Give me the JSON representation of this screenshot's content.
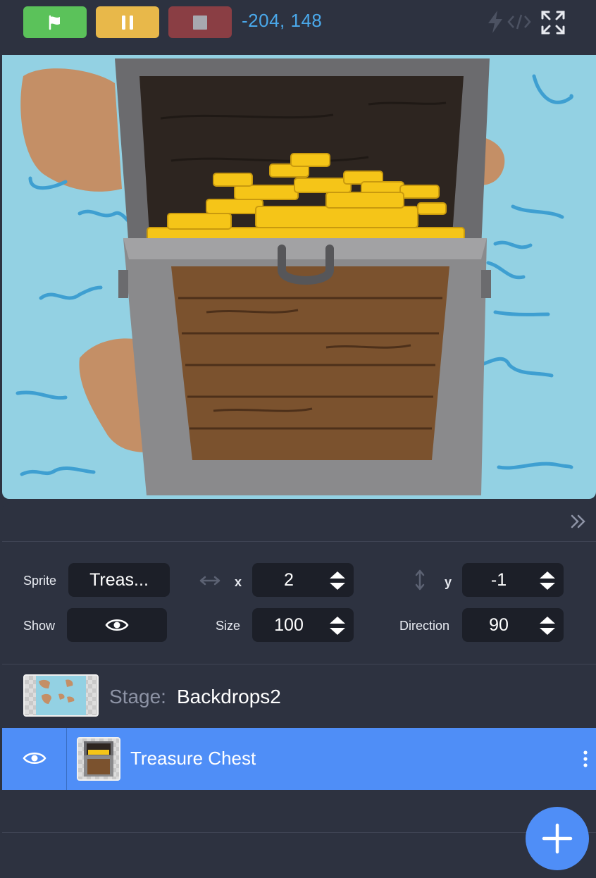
{
  "toolbar": {
    "coords": "-204,  148",
    "buttons": {
      "go": "flag-icon",
      "pause": "pause-icon",
      "stop": "stop-icon"
    },
    "icons": [
      "lightning-icon",
      "code-icon",
      "fullscreen-icon"
    ]
  },
  "sprite_props": {
    "sprite_label": "Sprite",
    "sprite_value": "Treas...",
    "x_label": "x",
    "x_value": "2",
    "y_label": "y",
    "y_value": "-1",
    "show_label": "Show",
    "size_label": "Size",
    "size_value": "100",
    "direction_label": "Direction",
    "direction_value": "90"
  },
  "stage_row": {
    "label": "Stage:",
    "name": "Backdrops2"
  },
  "sprite_list": [
    {
      "name": "Treasure Chest",
      "selected": true
    }
  ],
  "colors": {
    "background": "#2d3240",
    "go": "#5bc25a",
    "pause": "#e8b84a",
    "stop": "#8a3e44",
    "accent": "#4f8ef7",
    "coords": "#4aa8ea",
    "stage_sky": "#93d1e3"
  }
}
